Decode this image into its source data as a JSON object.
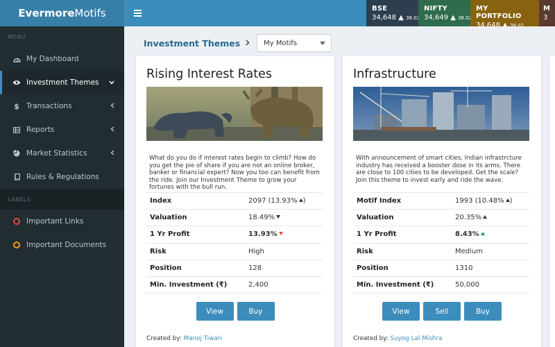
{
  "app": {
    "logo_bold": "Evermore",
    "logo_rest": "Motifs"
  },
  "tickers": [
    {
      "name": "BSE",
      "value": "34,648",
      "change": "38.02",
      "color": "#2d3e4f"
    },
    {
      "name": "NIFTY",
      "value": "34,649",
      "change": "38.02",
      "color": "#2f6b4d"
    },
    {
      "name": "MY PORTFOLIO",
      "value": "34,648",
      "change": "38.02",
      "color": "#876310"
    },
    {
      "name": "M",
      "value": "3",
      "color": "#5a3a2e"
    }
  ],
  "sidebar": {
    "menu_label": "MENU",
    "items": [
      {
        "label": "My Dashboard",
        "icon": "dashboard-icon"
      },
      {
        "label": "Investment Themes",
        "icon": "eye-icon",
        "active": true
      },
      {
        "label": "Transactions",
        "icon": "dollar-icon"
      },
      {
        "label": "Reports",
        "icon": "table-icon"
      },
      {
        "label": "Market Statistics",
        "icon": "pie-chart-icon"
      },
      {
        "label": "Rules & Regulations",
        "icon": "book-icon"
      }
    ],
    "labels_label": "LABELS",
    "labels": [
      {
        "label": "Important Links",
        "color": "#dd4b39"
      },
      {
        "label": "Important Documents",
        "color": "#f39c12"
      }
    ]
  },
  "breadcrumb": {
    "title": "Investment Themes",
    "select_value": "My Motifs"
  },
  "cards": [
    {
      "title": "Rising Interest Rates",
      "description": "What do you do if interest rates begin to climb? How do you get the pie of share if you are not an online broker, banker or financial expert? Now you too can benefit from the ride. Join our Investment Theme to grow your fortunes with the bull run.",
      "stats": [
        {
          "label": "Index",
          "value": "2097 (13.93%"
        },
        {
          "label": "Valuation",
          "value": "18.49%"
        },
        {
          "label": "1 Yr Profit",
          "value": "13.93%"
        },
        {
          "label": "Risk",
          "value": "High"
        },
        {
          "label": "Position",
          "value": "128"
        },
        {
          "label": "Min. Investment (₹)",
          "value": "2,400"
        }
      ],
      "buttons": [
        "View",
        "Buy"
      ],
      "created_prefix": "Created by:",
      "created_by": "Manoj Tiwari"
    },
    {
      "title": "Infrastructure",
      "description": "With announcement of smart cities, Indian infrastrcture industry has received a booster dose in its arms. There are close to 100 cities to be developed. Get the scale? Join this theme to invest early and ride the wave.",
      "stats": [
        {
          "label": "Motif Index",
          "value": "1993 (10.48%"
        },
        {
          "label": "Valuation",
          "value": "20.35%"
        },
        {
          "label": "1 Yr Profit",
          "value": "8.43%"
        },
        {
          "label": "Risk",
          "value": "Medium"
        },
        {
          "label": "Position",
          "value": "1310"
        },
        {
          "label": "Min. Investment (₹)",
          "value": "50,000"
        }
      ],
      "buttons": [
        "View",
        "Sell",
        "Buy"
      ],
      "created_prefix": "Created by:",
      "created_by": "Suyog Lal Mishra"
    }
  ]
}
